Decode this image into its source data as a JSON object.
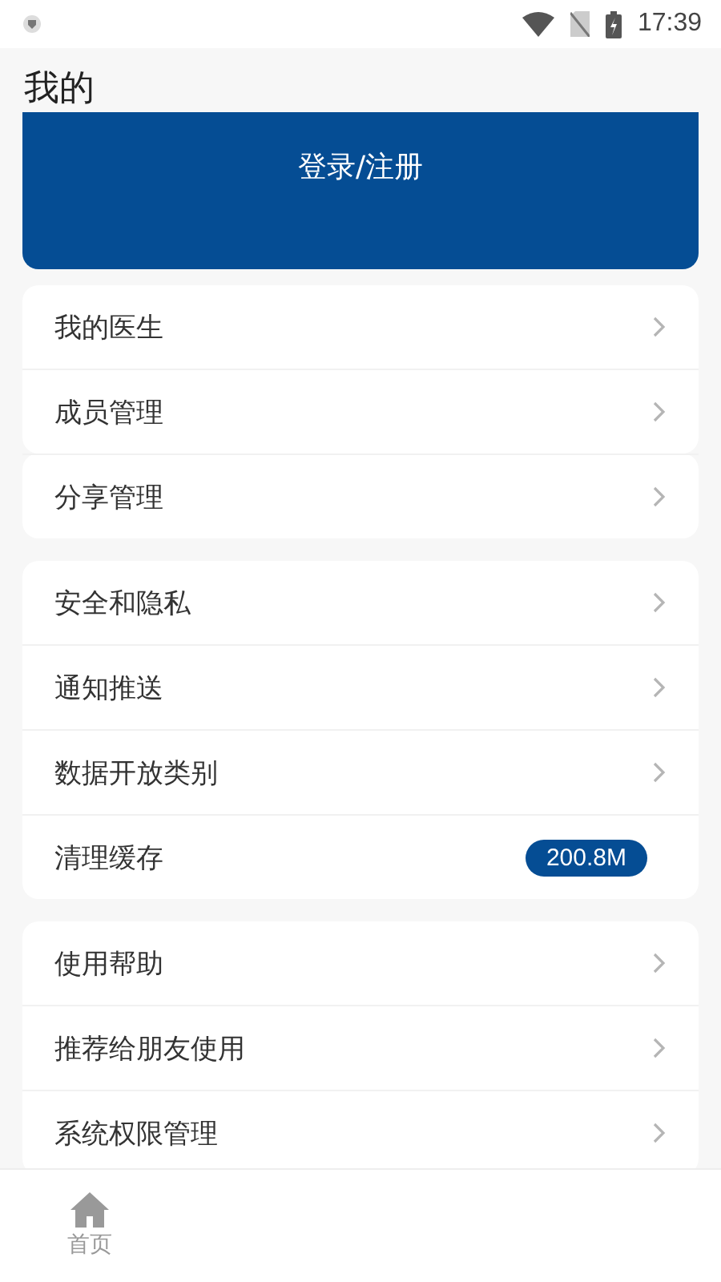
{
  "status_bar": {
    "time": "17:39"
  },
  "title": "我的",
  "login_button": "登录/注册",
  "groups": [
    {
      "items": [
        {
          "label": "我的医生",
          "kind": "link"
        },
        {
          "label": "成员管理",
          "kind": "link"
        }
      ]
    },
    {
      "items": [
        {
          "label": "分享管理",
          "kind": "link"
        }
      ]
    },
    {
      "items": [
        {
          "label": "安全和隐私",
          "kind": "link"
        },
        {
          "label": "通知推送",
          "kind": "link"
        },
        {
          "label": "数据开放类别",
          "kind": "link"
        },
        {
          "label": "清理缓存",
          "kind": "badge",
          "value": "200.8M"
        }
      ]
    },
    {
      "items": [
        {
          "label": "使用帮助",
          "kind": "link"
        },
        {
          "label": "推荐给朋友使用",
          "kind": "link"
        },
        {
          "label": "系统权限管理",
          "kind": "link"
        }
      ]
    }
  ],
  "bottom_nav": [
    {
      "label": "首页"
    }
  ]
}
